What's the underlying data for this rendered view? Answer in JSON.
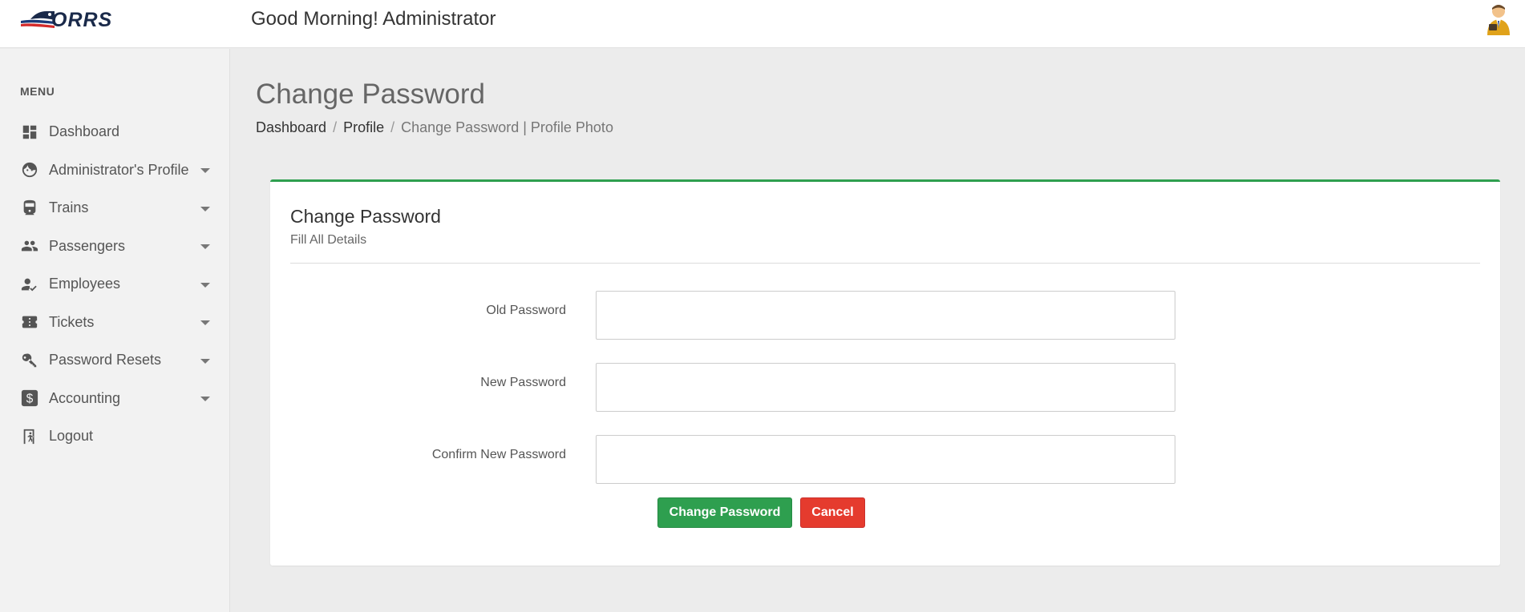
{
  "header": {
    "logo_text": "ORRS",
    "greeting": "Good Morning! Administrator",
    "avatar_icon": "user-avatar-icon"
  },
  "sidebar": {
    "menu_label": "MENU",
    "items": [
      {
        "label": "Dashboard",
        "icon": "dashboard-icon",
        "has_caret": false
      },
      {
        "label": "Administrator's Profile",
        "icon": "face-icon",
        "has_caret": true
      },
      {
        "label": "Trains",
        "icon": "train-icon",
        "has_caret": true
      },
      {
        "label": "Passengers",
        "icon": "people-icon",
        "has_caret": true
      },
      {
        "label": "Employees",
        "icon": "employee-check-icon",
        "has_caret": true
      },
      {
        "label": "Tickets",
        "icon": "ticket-icon",
        "has_caret": true
      },
      {
        "label": "Password Resets",
        "icon": "key-icon",
        "has_caret": true
      },
      {
        "label": "Accounting",
        "icon": "dollar-icon",
        "has_caret": true
      },
      {
        "label": "Logout",
        "icon": "exit-icon",
        "has_caret": false
      }
    ]
  },
  "main": {
    "page_title": "Change Password",
    "breadcrumb": {
      "dashboard": "Dashboard",
      "profile": "Profile",
      "current": "Change Password | Profile Photo",
      "separator": "/"
    },
    "card": {
      "title": "Change Password",
      "subtitle": "Fill All Details",
      "fields": {
        "old_password": {
          "label": "Old Password",
          "value": "",
          "placeholder": ""
        },
        "new_password": {
          "label": "New Password",
          "value": "",
          "placeholder": ""
        },
        "confirm_password": {
          "label": "Confirm New Password",
          "value": "",
          "placeholder": ""
        }
      },
      "buttons": {
        "save": "Change Password",
        "cancel": "Cancel"
      }
    }
  },
  "colors": {
    "accent_green": "#2e9f4f",
    "danger_red": "#e53b2e",
    "sidebar_bg": "#f2f2f2",
    "page_bg": "#ececec"
  }
}
